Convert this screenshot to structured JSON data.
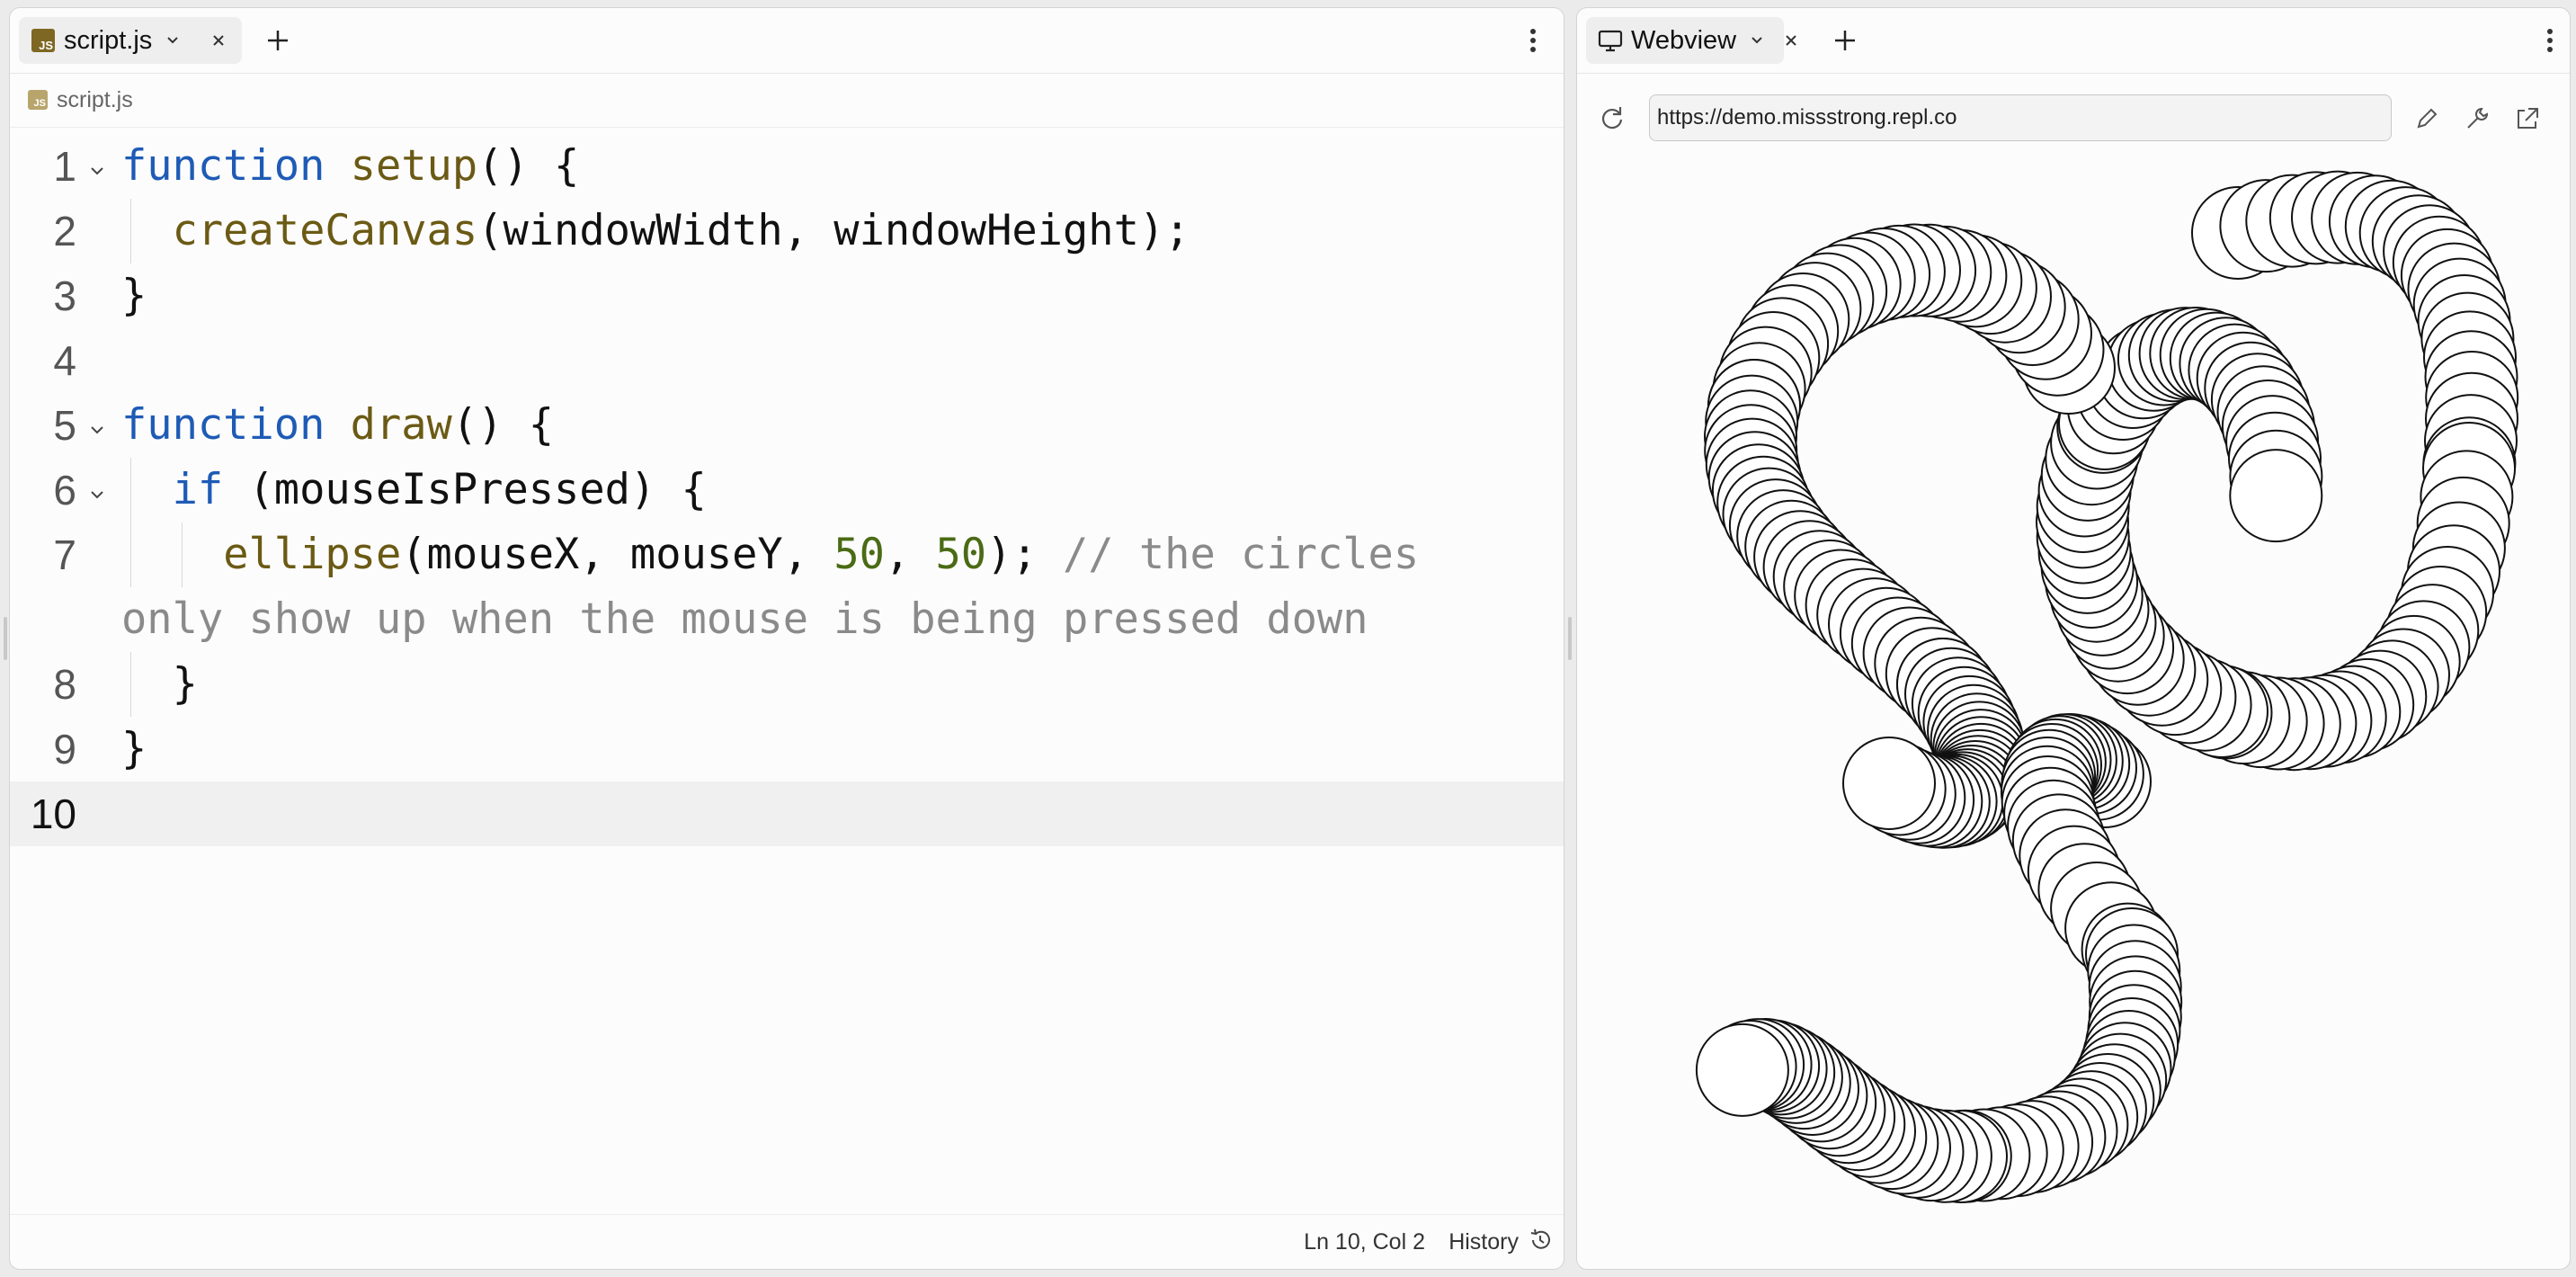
{
  "editor": {
    "tab_label": "script.js",
    "file_icon": "js-file-icon",
    "file_icon_text": "JS",
    "breadcrumb": "script.js",
    "lines": [
      {
        "num": "1"
      },
      {
        "num": "2"
      },
      {
        "num": "3"
      },
      {
        "num": "4"
      },
      {
        "num": "5"
      },
      {
        "num": "6"
      },
      {
        "num": "7"
      },
      {
        "num": "8"
      },
      {
        "num": "9"
      },
      {
        "num": "10"
      }
    ],
    "tokens": {
      "l1_kw": "function",
      "l1_fn": "setup",
      "l1_rest": "() {",
      "l2_fn": "createCanvas",
      "l2_rest": "(windowWidth, windowHeight);",
      "l3": "}",
      "l5_kw": "function",
      "l5_fn": "draw",
      "l5_rest": "() {",
      "l6_kw": "if",
      "l6_rest": " (mouseIsPressed) {",
      "l7_fn": "ellipse",
      "l7_a": "(mouseX, mouseY, ",
      "l7_n1": "50",
      "l7_comma": ", ",
      "l7_n2": "50",
      "l7_b": "); ",
      "l7_cm1": "// the circles",
      "l7_cm2": "only show up when the mouse is being pressed down",
      "l8": "}",
      "l9": "}"
    },
    "status": {
      "position": "Ln 10, Col 2",
      "history": "History"
    }
  },
  "webview": {
    "tab_label": "Webview",
    "url": "https://demo.missstrong.repl.co"
  },
  "colors": {
    "keyword": "#1e5bb5",
    "function": "#6b5a14",
    "number": "#4a6b14",
    "comment": "#8a8a8a"
  }
}
